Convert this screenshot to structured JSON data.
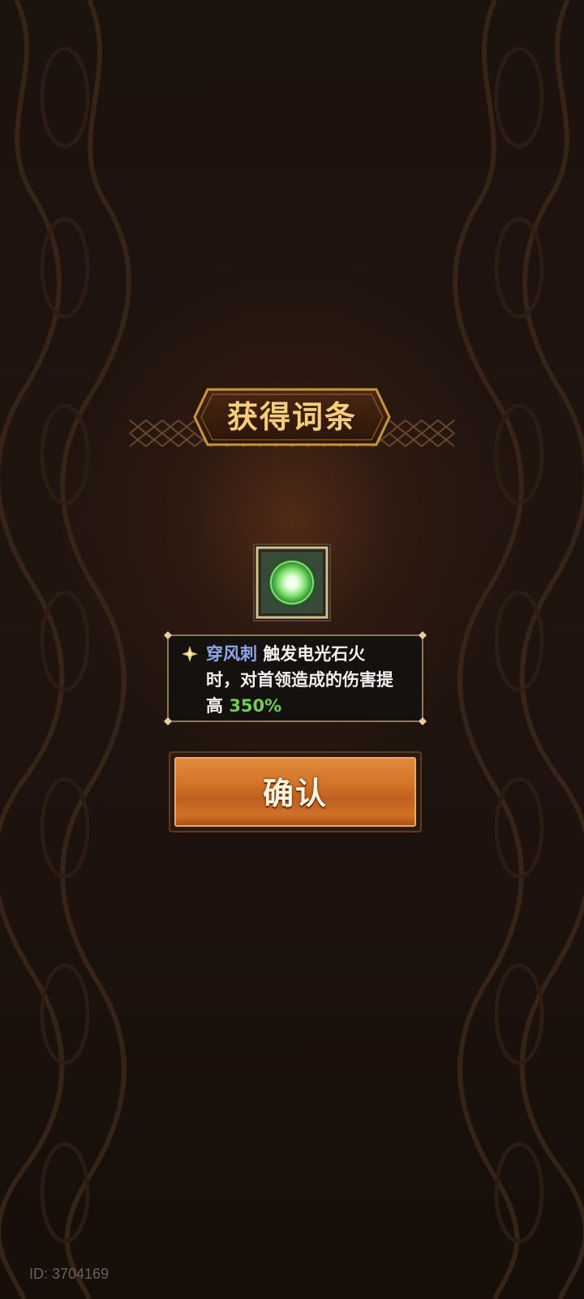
{
  "dialog": {
    "title": "获得词条"
  },
  "item": {
    "icon": "green-orb-icon",
    "name": "穿风刺",
    "description_line1": "触发电光石火",
    "description_line2": "时，对首领造成的伤害提",
    "description_line3_prefix": "高",
    "value": "350%"
  },
  "confirm_button": {
    "label": "确认"
  },
  "footer": {
    "id_text": "ID: 3704169"
  },
  "colors": {
    "title": "#f4cf7a",
    "skill_name": "#8fa6e8",
    "skill_value": "#6fd14a",
    "button": "#d4762a"
  }
}
